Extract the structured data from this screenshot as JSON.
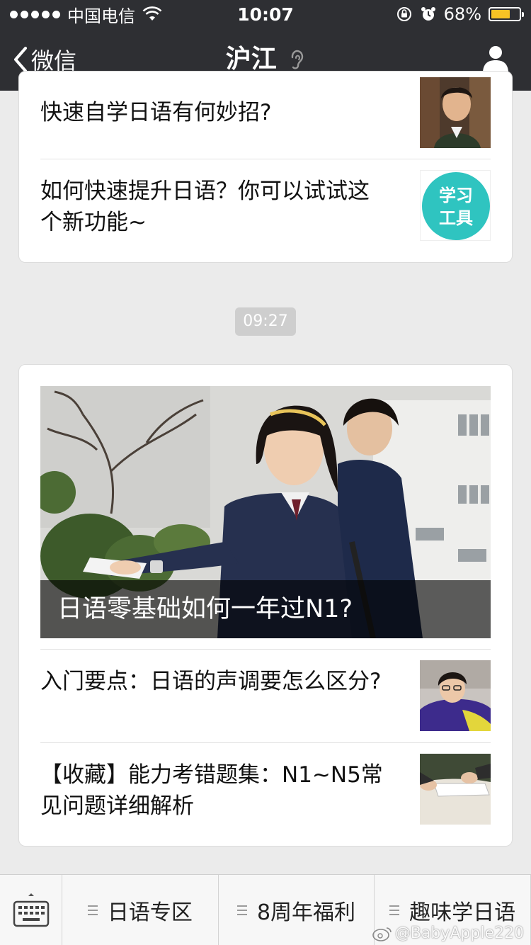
{
  "status_bar": {
    "carrier": "中国电信",
    "time": "10:07",
    "battery_percent": "68%",
    "battery_level": 0.68,
    "battery_color": "#f7c325"
  },
  "nav": {
    "back_label": "微信",
    "title": "沪江",
    "title_icon": "ear-icon",
    "right_icon": "profile-icon"
  },
  "card1": {
    "items": [
      {
        "title": "快速自学日语有何妙招?",
        "thumb": "man-portrait"
      },
      {
        "title": "如何快速提升日语？你可以试试这个新功能~",
        "thumb_text_1": "学习",
        "thumb_text_2": "工具",
        "thumb_color": "#2fc4c0"
      }
    ]
  },
  "timestamp": "09:27",
  "card2": {
    "hero_caption": "日语零基础如何一年过N1?",
    "items": [
      {
        "title": "入门要点：日语的声调要怎么区分?",
        "thumb": "student-portrait"
      },
      {
        "title": "【收藏】能力考错题集：N1~N5常见问题详细解析",
        "thumb": "writing-hands"
      }
    ]
  },
  "bottom_menu": {
    "keyboard_icon": "keyboard-icon",
    "items": [
      {
        "label": "日语专区"
      },
      {
        "label": "8周年福利"
      },
      {
        "label": "趣味学日语"
      }
    ]
  },
  "watermark": "@BabyApple220",
  "colors": {
    "nav_bg": "#2e2f33",
    "page_bg": "#ebebeb",
    "accent_teal": "#2fc4c0"
  }
}
